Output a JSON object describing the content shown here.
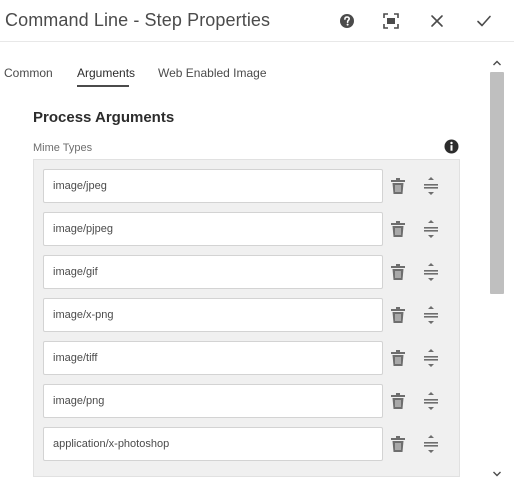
{
  "dialog": {
    "title": "Command Line - Step Properties",
    "toolbar_icons": [
      "help-icon",
      "fullscreen-icon",
      "close-icon",
      "checkmark-icon"
    ]
  },
  "tabs": [
    {
      "label": "Common",
      "selected": false
    },
    {
      "label": "Arguments",
      "selected": true
    },
    {
      "label": "Web Enabled Image",
      "selected": false
    }
  ],
  "section": {
    "title": "Process Arguments",
    "field_label": "Mime Types"
  },
  "mime_types": [
    {
      "value": "image/jpeg"
    },
    {
      "value": "image/pjpeg"
    },
    {
      "value": "image/gif"
    },
    {
      "value": "image/x-png"
    },
    {
      "value": "image/tiff"
    },
    {
      "value": "image/png"
    },
    {
      "value": "application/x-photoshop"
    }
  ],
  "colors": {
    "background": "#ffffff",
    "multifield_background": "#f0f0f0",
    "text": "#4b4b4b",
    "scroll_thumb": "#bfbfbf"
  }
}
